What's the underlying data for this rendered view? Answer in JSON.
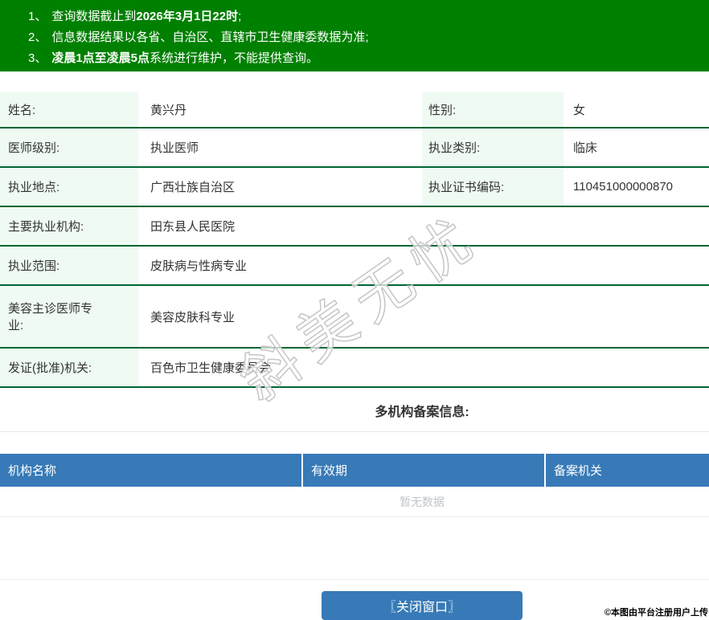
{
  "notice": {
    "lines": [
      {
        "num": "1、",
        "pre": "查询数据截止到",
        "bold": "2026年3月1日22时",
        "post": ";"
      },
      {
        "num": "2、",
        "pre": "信息数据结果以各省、自治区、直辖市卫生健康委数据为准;",
        "bold": "",
        "post": ""
      },
      {
        "num": "3、",
        "pre": "",
        "bold": "凌晨1点至凌晨5点",
        "post": "系统进行维护，不能提供查询。"
      }
    ]
  },
  "info": {
    "rows": [
      {
        "label": "姓名:",
        "value": "黄兴丹",
        "label2": "性别:",
        "value2": "女"
      },
      {
        "label": "医师级别:",
        "value": "执业医师",
        "label2": "执业类别:",
        "value2": "临床"
      },
      {
        "label": "执业地点:",
        "value": "广西壮族自治区",
        "label2": "执业证书编码:",
        "value2": "110451000000870"
      },
      {
        "label": "主要执业机构:",
        "value": "田东县人民医院"
      },
      {
        "label": "执业范围:",
        "value": "皮肤病与性病专业"
      },
      {
        "label": "美容主诊医师专业:",
        "value": "美容皮肤科专业"
      },
      {
        "label": "发证(批准)机关:",
        "value": "百色市卫生健康委员会"
      }
    ]
  },
  "records": {
    "title": "多机构备案信息:",
    "columns": [
      "机构名称",
      "有效期",
      "备案机关"
    ],
    "empty_text": "暂无数据"
  },
  "close_button_label": "〖关闭窗口〗",
  "watermark_text": "斜美无忧",
  "stamp_text": "©本图由平台注册用户上传",
  "colors": {
    "notice_green": "#008000",
    "row_border_green": "#006633",
    "label_bg_mint": "#eefaf2",
    "table_blue": "#377ab7",
    "empty_text_gray": "#c0c4cc"
  }
}
